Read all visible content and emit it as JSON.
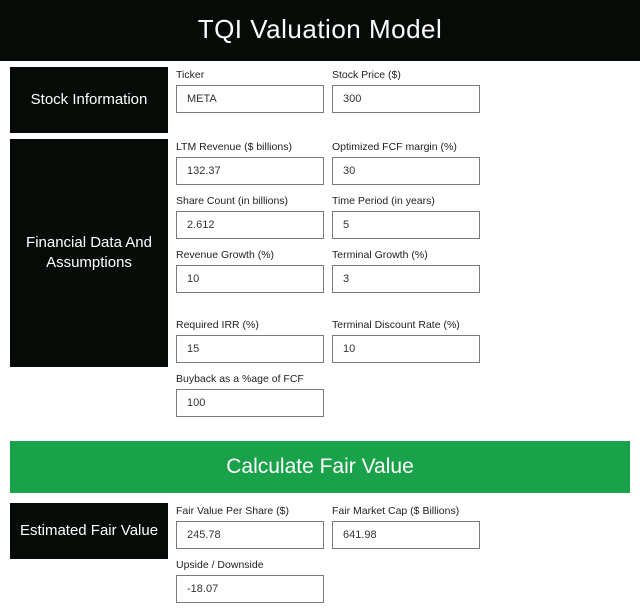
{
  "title": "TQI Valuation Model",
  "sections": {
    "stock": {
      "label": "Stock Information"
    },
    "fin": {
      "label": "Financial Data And Assumptions"
    },
    "est": {
      "label": "Estimated Fair Value"
    }
  },
  "stock": {
    "ticker": {
      "label": "Ticker",
      "value": "META"
    },
    "price": {
      "label": "Stock Price ($)",
      "value": "300"
    }
  },
  "fin": {
    "ltm_revenue": {
      "label": "LTM Revenue ($ billions)",
      "value": "132.37"
    },
    "fcf_margin": {
      "label": "Optimized FCF margin (%)",
      "value": "30"
    },
    "share_count": {
      "label": "Share Count (in billions)",
      "value": "2.612"
    },
    "time_period": {
      "label": "Time Period (in years)",
      "value": "5"
    },
    "rev_growth": {
      "label": "Revenue Growth (%)",
      "value": "10"
    },
    "term_growth": {
      "label": "Terminal Growth (%)",
      "value": "3"
    },
    "req_irr": {
      "label": "Required IRR (%)",
      "value": "15"
    },
    "term_disc": {
      "label": "Terminal Discount Rate (%)",
      "value": "10"
    },
    "buyback": {
      "label": "Buyback as a %age of FCF",
      "value": "100"
    }
  },
  "calc_button": "Calculate Fair Value",
  "est": {
    "fv_per_share": {
      "label": "Fair Value Per Share ($)",
      "value": "245.78"
    },
    "fair_mcap": {
      "label": "Fair Market Cap ($ Billions)",
      "value": "641.98"
    },
    "upside": {
      "label": "Upside / Downside",
      "value": "-18.07"
    }
  }
}
